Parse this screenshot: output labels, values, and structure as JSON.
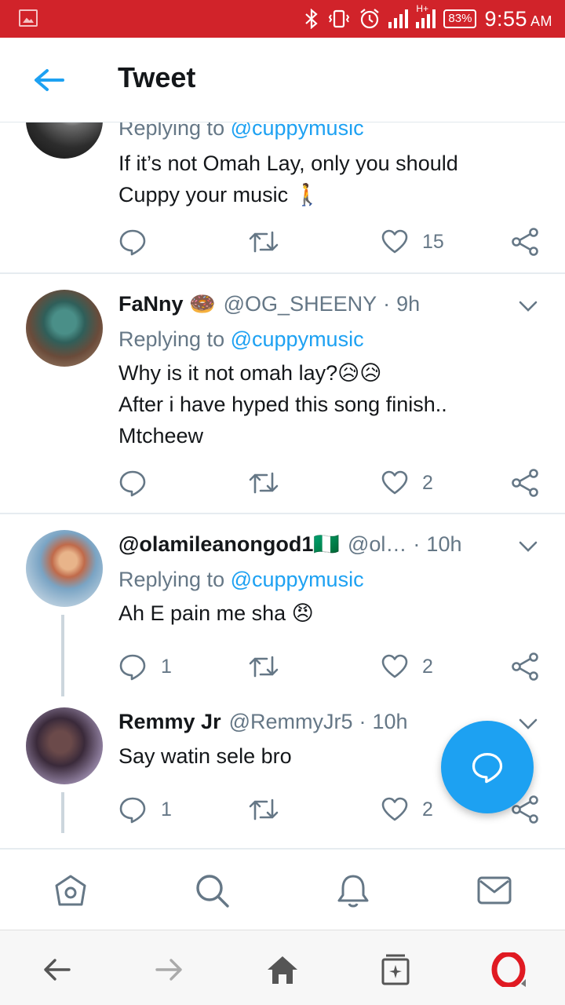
{
  "status_bar": {
    "battery": "83%",
    "time": "9:55",
    "ampm": "AM",
    "network": "H+",
    "icons": [
      "image-icon",
      "bluetooth-icon",
      "vibrate-icon",
      "alarm-icon",
      "signal-icon",
      "signal-icon",
      "battery-icon"
    ]
  },
  "header": {
    "title": "Tweet",
    "back_icon": "back-arrow-icon"
  },
  "colors": {
    "accent": "#1da1f2",
    "status_bar": "#d1232a",
    "secondary_text": "#657786"
  },
  "tweets": [
    {
      "reply_prefix": "Replying to",
      "reply_to": "@cuppymusic",
      "text_lines": [
        "If it’s not Omah Lay, only you should",
        "Cuppy your music 🚶"
      ],
      "likes": "15"
    },
    {
      "name": "FaNny 🍩",
      "handle": "@OG_SHEENY",
      "dot": "·",
      "time": "9h",
      "reply_prefix": "Replying to",
      "reply_to": "@cuppymusic",
      "text_lines": [
        "Why is it not omah lay?😥😥",
        "After i have hyped this song finish..",
        "Mtcheew"
      ],
      "likes": "2"
    },
    {
      "name": "@olamileanongod1🇳🇬",
      "handle": "@ol…",
      "dot": "·",
      "time": "10h",
      "reply_prefix": "Replying to",
      "reply_to": "@cuppymusic",
      "text_lines": [
        "Ah E pain me sha 😠"
      ],
      "replies": "1",
      "likes": "2"
    },
    {
      "name": "Remmy Jr",
      "handle": "@RemmyJr5",
      "dot": "·",
      "time": "10h",
      "text_lines": [
        "Say watin sele bro"
      ],
      "replies": "1",
      "likes": "2"
    }
  ],
  "tabs": [
    "home-icon",
    "search-icon",
    "notifications-icon",
    "messages-icon"
  ],
  "browser_nav": [
    "back-icon",
    "forward-icon",
    "home-icon",
    "tabs-icon",
    "opera-icon"
  ]
}
